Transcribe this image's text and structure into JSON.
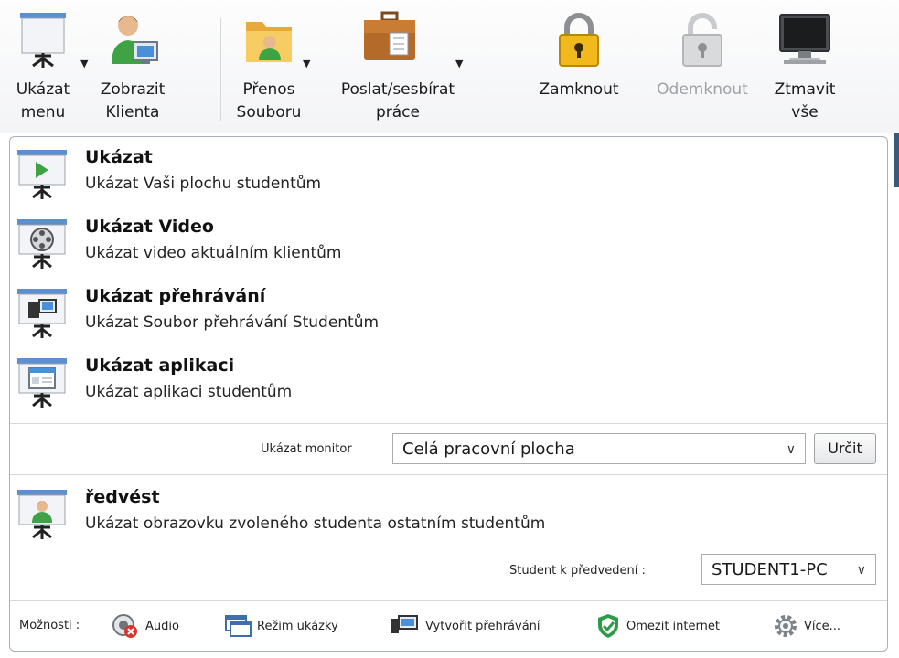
{
  "toolbar": {
    "show_menu": {
      "line1": "Ukázat",
      "line2": "menu",
      "icon": "presentation-screen-icon"
    },
    "view_client": {
      "line1": "Zobrazit",
      "line2": "Klienta",
      "icon": "user-monitor-icon"
    },
    "file_transfer": {
      "line1": "Přenos",
      "line2": "Souboru",
      "icon": "folder-user-icon"
    },
    "send_collect": {
      "line1": "Poslat/sesbírat",
      "line2": "práce",
      "icon": "briefcase-icon"
    },
    "lock": {
      "line1": "Zamknout",
      "icon": "padlock-icon"
    },
    "unlock": {
      "line1": "Odemknout",
      "icon": "open-padlock-icon",
      "disabled": true
    },
    "blank_all": {
      "line1": "Ztmavit",
      "line2": "vše",
      "icon": "monitor-icon"
    }
  },
  "menu": {
    "items": [
      {
        "title": "Ukázat",
        "desc": "Ukázat Vaši plochu studentům",
        "icon": "play-presentation-icon"
      },
      {
        "title": "Ukázat Video",
        "desc": "Ukázat video aktuálním klientům",
        "icon": "film-reel-presentation-icon"
      },
      {
        "title": "Ukázat přehrávání",
        "desc": "Ukázat Soubor přehrávání Studentům",
        "icon": "camera-presentation-icon"
      },
      {
        "title": "Ukázat aplikaci",
        "desc": "Ukázat aplikaci studentům",
        "icon": "application-presentation-icon"
      }
    ],
    "monitor": {
      "label": "Ukázat monitor",
      "value": "Celá pracovní plocha",
      "button": "Určit"
    },
    "exhibit": {
      "title": "ředvést",
      "desc": "Ukázat obrazovku zvoleného studenta ostatním studentům",
      "student_label": "Student k předvedení :",
      "student_value": "STUDENT1-PC",
      "icon": "student-presentation-icon"
    },
    "options": {
      "label": "Možnosti :",
      "audio": "Audio",
      "mode": "Režim ukázky",
      "create_replay": "Vytvořit přehrávání",
      "restrict_internet": "Omezit internet",
      "more": "Více..."
    }
  },
  "colors": {
    "accent": "#3d6fb0",
    "disabled_text": "#9ea2a6",
    "panel_border": "#a9b0b8"
  }
}
